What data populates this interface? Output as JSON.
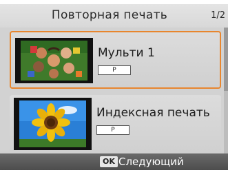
{
  "header": {
    "title": "Повторная печать",
    "page_indicator": "1/2"
  },
  "items": [
    {
      "label": "Мульти 1",
      "badge": "P",
      "selected": true,
      "thumbnail_icon": "children-photo-icon"
    },
    {
      "label": "Индексная печать",
      "badge": "P",
      "selected": false,
      "thumbnail_icon": "sunflower-photo-icon"
    }
  ],
  "footer": {
    "ok_key": "OK",
    "next_label": "Следующий"
  },
  "colors": {
    "selection_border": "#e8862e",
    "footer_bg": "#555555"
  }
}
